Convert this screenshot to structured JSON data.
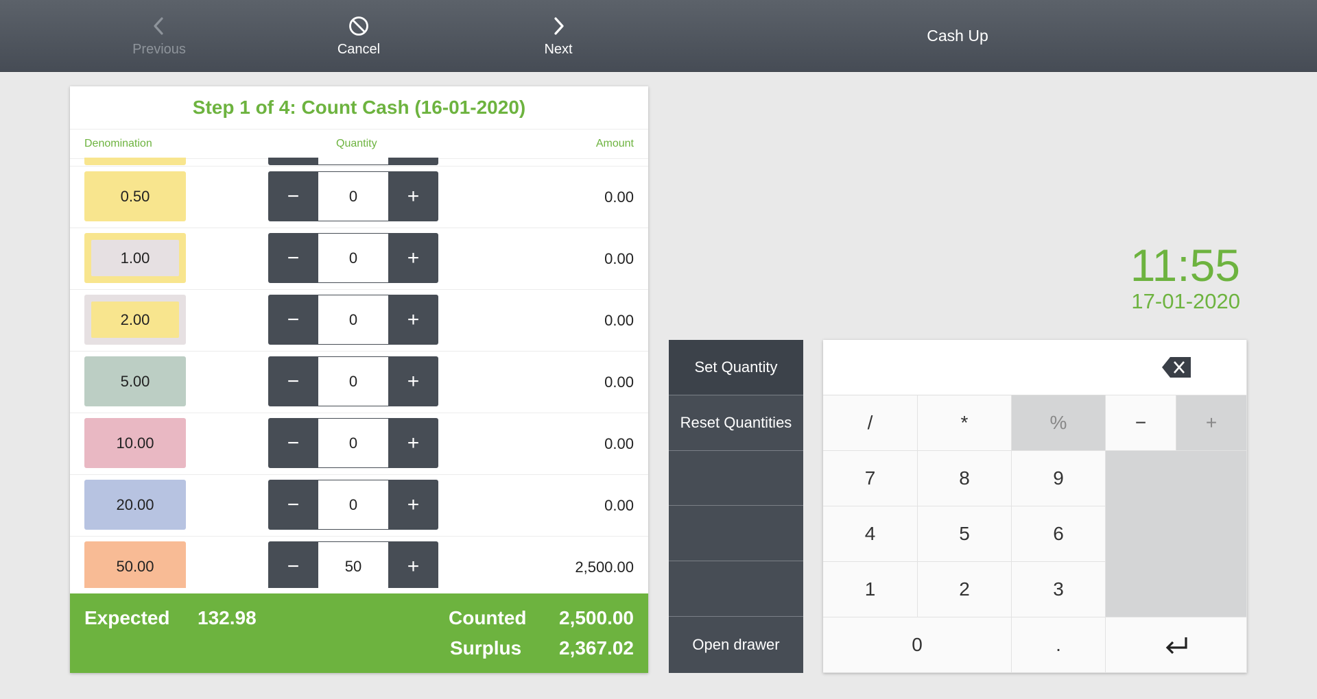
{
  "topbar": {
    "previous_label": "Previous",
    "cancel_label": "Cancel",
    "next_label": "Next",
    "title": "Cash Up"
  },
  "panel": {
    "step_title": "Step 1 of 4: Count Cash (16-01-2020)",
    "headers": {
      "denomination": "Denomination",
      "quantity": "Quantity",
      "amount": "Amount"
    },
    "rows": [
      {
        "denomination": "0.50",
        "quantity": "0",
        "amount": "0.00",
        "color": "#f8e58e",
        "inner": ""
      },
      {
        "denomination": "1.00",
        "quantity": "0",
        "amount": "0.00",
        "color": "#f8e58e",
        "inner": "#e6e0e2"
      },
      {
        "denomination": "2.00",
        "quantity": "0",
        "amount": "0.00",
        "color": "#e6e0e2",
        "inner": "#f8e58e"
      },
      {
        "denomination": "5.00",
        "quantity": "0",
        "amount": "0.00",
        "color": "#bccec4",
        "inner": ""
      },
      {
        "denomination": "10.00",
        "quantity": "0",
        "amount": "0.00",
        "color": "#e9b8c3",
        "inner": ""
      },
      {
        "denomination": "20.00",
        "quantity": "0",
        "amount": "0.00",
        "color": "#b7c3e1",
        "inner": ""
      },
      {
        "denomination": "50.00",
        "quantity": "50",
        "amount": "2,500.00",
        "color": "#f8bb95",
        "inner": ""
      }
    ],
    "summary": {
      "expected_label": "Expected",
      "expected_value": "132.98",
      "counted_label": "Counted",
      "counted_value": "2,500.00",
      "surplus_label": "Surplus",
      "surplus_value": "2,367.02"
    }
  },
  "actions": {
    "set_quantity": "Set Quantity",
    "reset_quantities": "Reset Quantities",
    "open_drawer": "Open drawer"
  },
  "clock": {
    "time": "11:55",
    "date": "17-01-2020"
  },
  "keypad": {
    "display_value": "",
    "keys": {
      "divide": "/",
      "multiply": "*",
      "percent": "%",
      "minus": "−",
      "plus": "+",
      "k7": "7",
      "k8": "8",
      "k9": "9",
      "k4": "4",
      "k5": "5",
      "k6": "6",
      "k1": "1",
      "k2": "2",
      "k3": "3",
      "k0": "0",
      "dot": "."
    }
  },
  "colors": {
    "accent": "#6db33f",
    "dark": "#474d55"
  }
}
